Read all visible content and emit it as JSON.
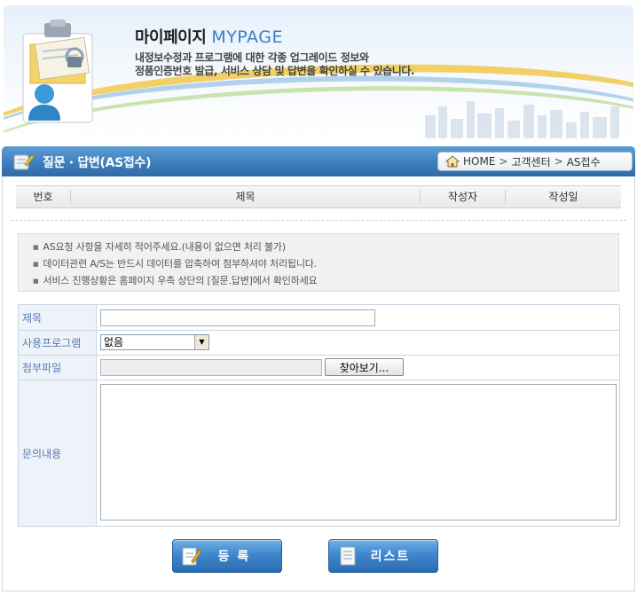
{
  "banner": {
    "title_ko": "마이페이지",
    "title_en": "MYPAGE",
    "desc_line1": "내정보수정과 프로그램에 대한 각종 업그레이드 정보와",
    "desc_line2": "정품인증번호 발급, 서비스 상담 및 답변을 확인하실 수 있습니다."
  },
  "titlebar": {
    "title": "질문 · 답변(AS접수)",
    "breadcrumb": [
      "HOME",
      "고객센터",
      "AS접수"
    ],
    "breadcrumb_sep": ">"
  },
  "list_header": [
    "번호",
    "제목",
    "작성자",
    "작성일"
  ],
  "notice": [
    "AS요청 사항을 자세히 적어주세요.(내용이 없으면 처리 불가)",
    "데이터관련 A/S는 반드시 데이터를 압축하여 첨부하셔야 처리됩니다.",
    "서비스 진행상황은 홈페이지 우측 상단의 [질문.답변]에서 확인하세요"
  ],
  "form": {
    "subject_label": "제목",
    "subject_value": "",
    "program_label": "사용프로그램",
    "program_selected": "없음",
    "attach_label": "첨부파일",
    "attach_value": "",
    "browse_label": "찾아보기...",
    "content_label": "문의내용",
    "content_value": ""
  },
  "buttons": {
    "register": "등 록",
    "list": "리스트"
  },
  "colors": {
    "titlebar_blue": "#3f7fbd",
    "label_bg": "#eef3f9",
    "label_text": "#557bb0",
    "button_blue": "#3f86cc",
    "mypage_blue": "#3b7fc6"
  },
  "icons": {
    "banner": "clipboard-user-icon",
    "title": "note-pencil-icon",
    "home": "home-icon",
    "register": "pencil-note-icon",
    "list": "document-list-icon"
  }
}
